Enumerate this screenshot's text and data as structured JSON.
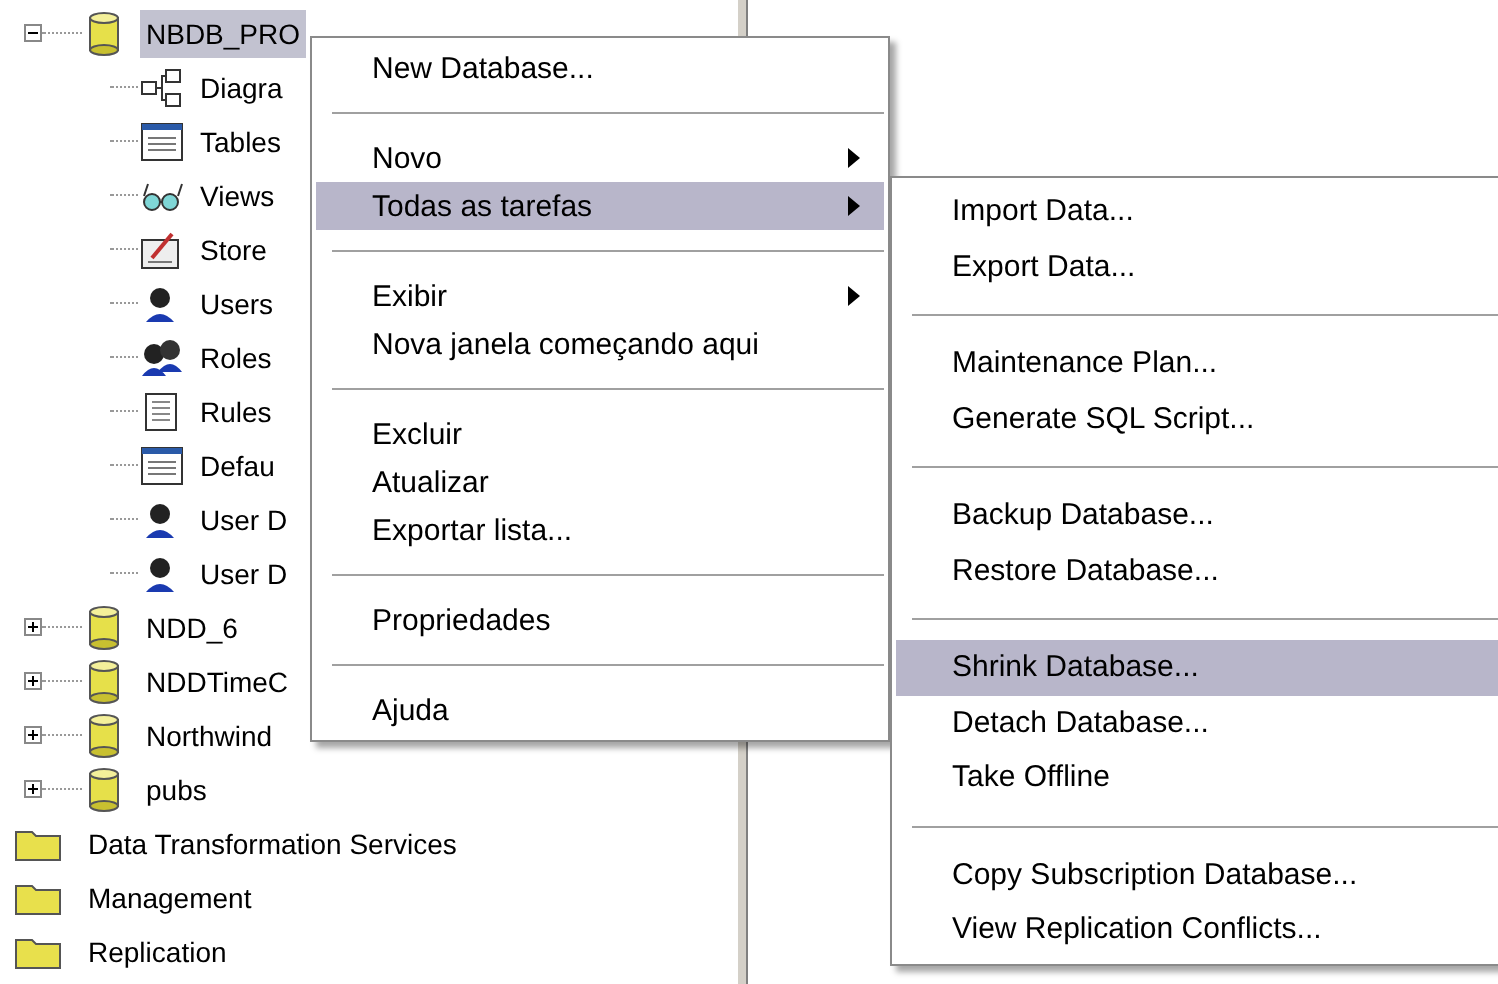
{
  "tree": {
    "items": [
      {
        "kind": "database",
        "label": "NBDB_PRO",
        "expanded": true,
        "selected": true,
        "children": [
          {
            "kind": "diagram",
            "label": "Diagra"
          },
          {
            "kind": "table",
            "label": "Tables"
          },
          {
            "kind": "glasses",
            "label": "Views"
          },
          {
            "kind": "procedure",
            "label": "Store"
          },
          {
            "kind": "user",
            "label": "Users"
          },
          {
            "kind": "users",
            "label": "Roles"
          },
          {
            "kind": "page",
            "label": "Rules"
          },
          {
            "kind": "table",
            "label": "Defau"
          },
          {
            "kind": "user",
            "label": "User D"
          },
          {
            "kind": "user",
            "label": "User D"
          }
        ]
      },
      {
        "kind": "database",
        "label": "NDD_6",
        "expanded": false,
        "selected": false
      },
      {
        "kind": "database",
        "label": "NDDTimeC",
        "expanded": false,
        "selected": false
      },
      {
        "kind": "database",
        "label": "Northwind",
        "expanded": false,
        "selected": false
      },
      {
        "kind": "database",
        "label": "pubs",
        "expanded": false,
        "selected": false
      },
      {
        "kind": "folder",
        "label": "Data Transformation Services",
        "selected": false
      },
      {
        "kind": "folder",
        "label": "Management",
        "selected": false
      },
      {
        "kind": "folder",
        "label": "Replication",
        "selected": false
      }
    ]
  },
  "context_menu": {
    "items": [
      {
        "kind": "item",
        "label": "New Database...",
        "submenu": false,
        "selected": false
      },
      {
        "kind": "separator"
      },
      {
        "kind": "item",
        "label": "Novo",
        "submenu": true,
        "selected": false
      },
      {
        "kind": "item",
        "label": "Todas as tarefas",
        "submenu": true,
        "selected": true
      },
      {
        "kind": "separator"
      },
      {
        "kind": "item",
        "label": "Exibir",
        "submenu": true,
        "selected": false
      },
      {
        "kind": "item",
        "label": "Nova janela começando aqui",
        "submenu": false,
        "selected": false
      },
      {
        "kind": "separator"
      },
      {
        "kind": "item",
        "label": "Excluir",
        "submenu": false,
        "selected": false
      },
      {
        "kind": "item",
        "label": "Atualizar",
        "submenu": false,
        "selected": false
      },
      {
        "kind": "item",
        "label": "Exportar lista...",
        "submenu": false,
        "selected": false
      },
      {
        "kind": "separator"
      },
      {
        "kind": "item",
        "label": "Propriedades",
        "submenu": false,
        "selected": false
      },
      {
        "kind": "separator"
      },
      {
        "kind": "item",
        "label": "Ajuda",
        "submenu": false,
        "selected": false
      }
    ]
  },
  "submenu": {
    "items": [
      {
        "kind": "item",
        "label": "Import Data...",
        "selected": false
      },
      {
        "kind": "item",
        "label": "Export Data...",
        "selected": false
      },
      {
        "kind": "separator"
      },
      {
        "kind": "item",
        "label": "Maintenance Plan...",
        "selected": false
      },
      {
        "kind": "item",
        "label": "Generate SQL Script...",
        "selected": false
      },
      {
        "kind": "separator"
      },
      {
        "kind": "item",
        "label": "Backup Database...",
        "selected": false
      },
      {
        "kind": "item",
        "label": "Restore Database...",
        "selected": false
      },
      {
        "kind": "separator"
      },
      {
        "kind": "item",
        "label": "Shrink Database...",
        "selected": true
      },
      {
        "kind": "item",
        "label": "Detach Database...",
        "selected": false
      },
      {
        "kind": "item",
        "label": "Take Offline",
        "selected": false
      },
      {
        "kind": "separator"
      },
      {
        "kind": "item",
        "label": "Copy Subscription Database...",
        "selected": false
      },
      {
        "kind": "item",
        "label": "View Replication Conflicts...",
        "selected": false
      }
    ]
  }
}
